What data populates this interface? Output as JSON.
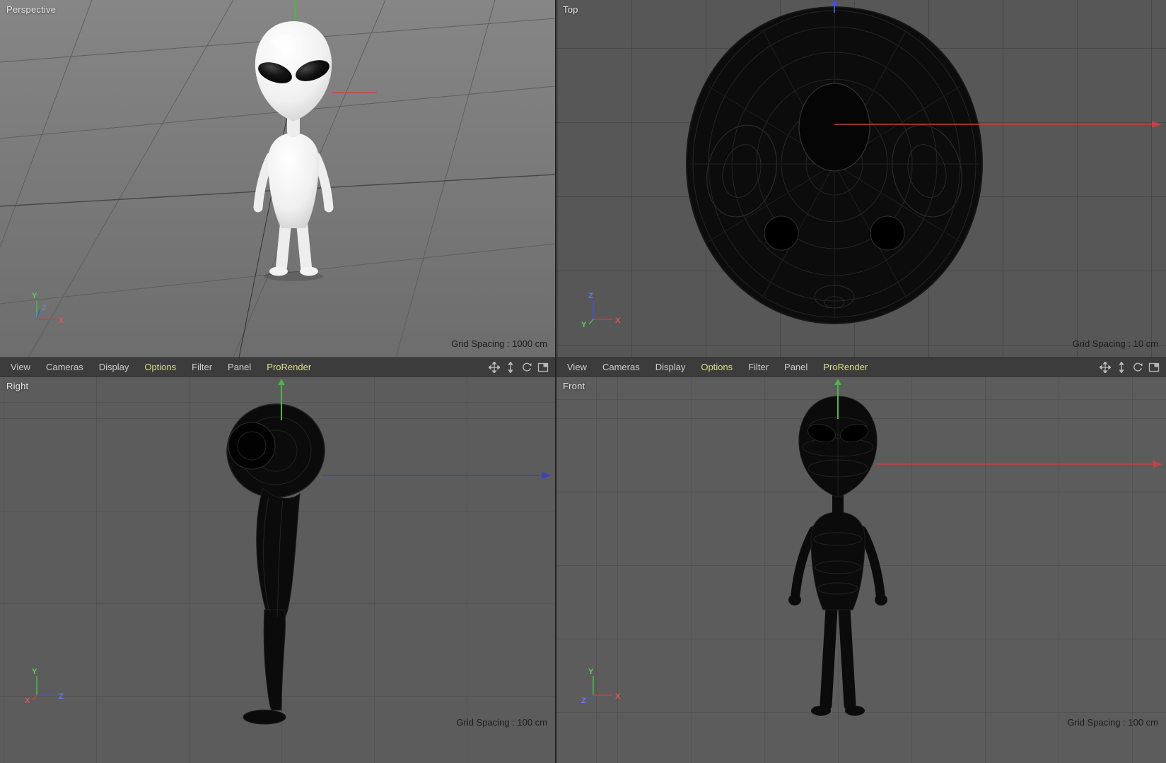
{
  "menu": {
    "items": [
      "View",
      "Cameras",
      "Display",
      "Options",
      "Filter",
      "Panel",
      "ProRender"
    ],
    "icons": [
      "pan",
      "dolly",
      "rotate",
      "toggle-layout"
    ]
  },
  "viewports": {
    "perspective": {
      "label": "Perspective",
      "grid_spacing": "Grid Spacing : 1000 cm",
      "axis": {
        "y": "Y",
        "z": "Z",
        "x": "X"
      }
    },
    "top": {
      "label": "Top",
      "grid_spacing": "Grid Spacing : 10 cm",
      "axis": {
        "y": "Y",
        "z": "Z",
        "x": "X"
      }
    },
    "right": {
      "label": "Right",
      "grid_spacing": "Grid Spacing : 100 cm",
      "axis": {
        "y": "Y",
        "z": "Z",
        "x": "X"
      }
    },
    "front": {
      "label": "Front",
      "grid_spacing": "Grid Spacing : 100 cm",
      "axis": {
        "y": "Y",
        "z": "Z",
        "x": "X"
      }
    }
  },
  "colors": {
    "axis_x": "#cc4040",
    "axis_y": "#46b946",
    "axis_z": "#4852d8",
    "menu_highlight": "#dede8c",
    "menubar_bg": "#3c3c3c"
  }
}
